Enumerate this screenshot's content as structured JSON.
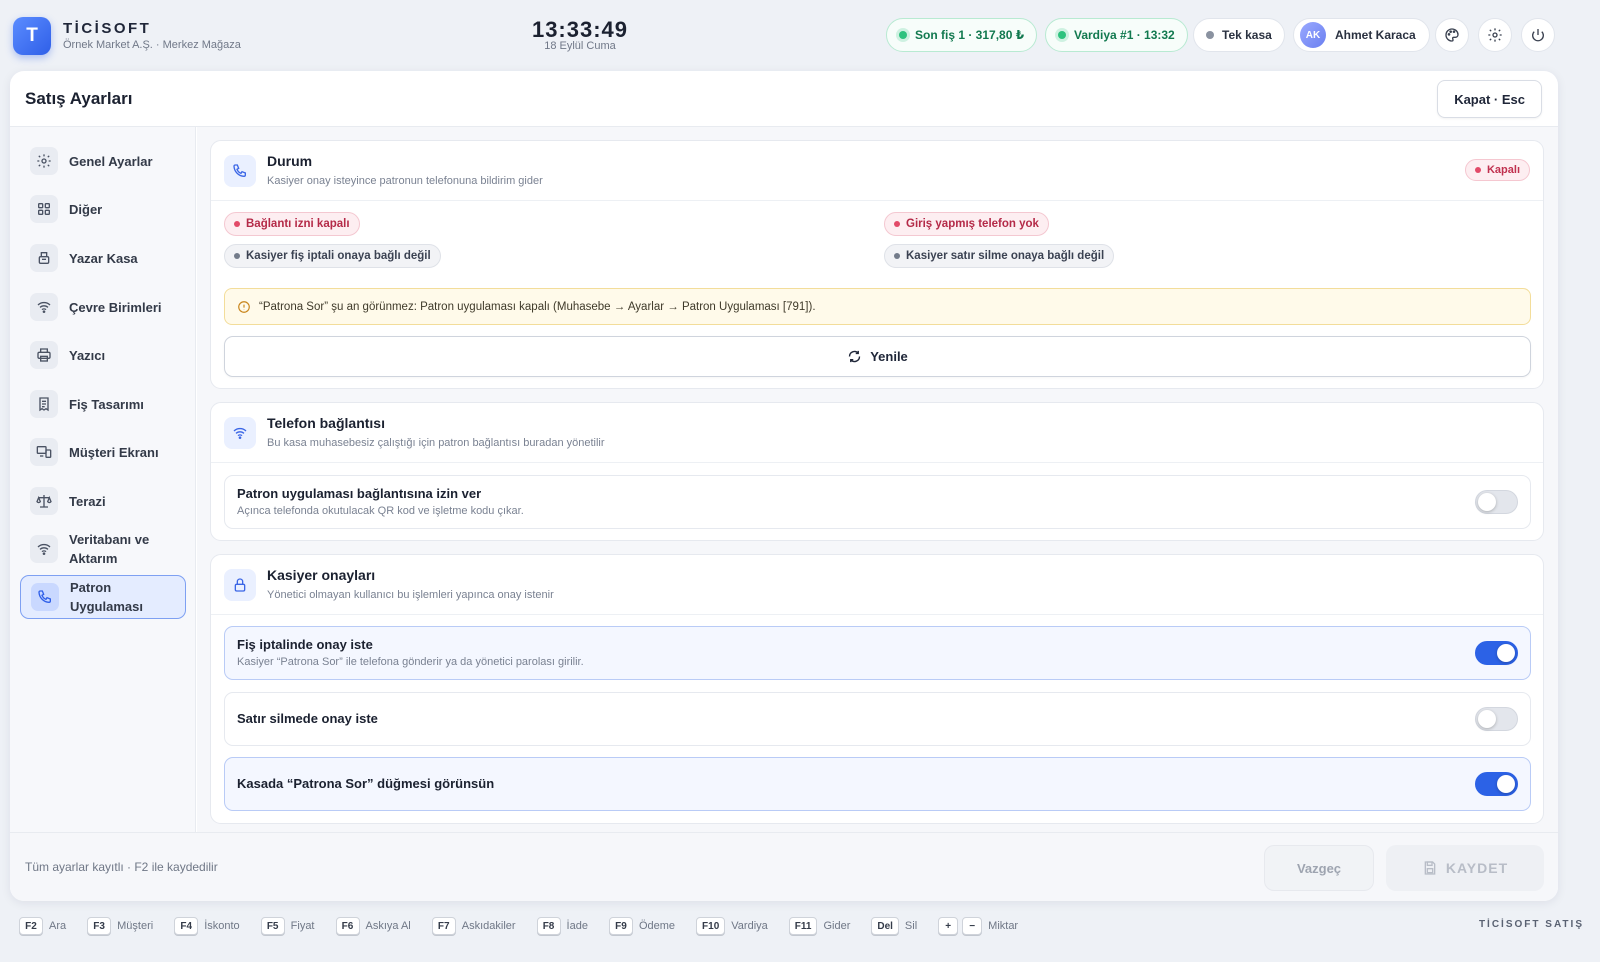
{
  "header": {
    "logo_letter": "T",
    "brand": "TİCİSOFT",
    "subtitle": "Örnek Market A.Ş. · Merkez Mağaza",
    "clock": "13:33:49",
    "date": "18 Eylül Cuma",
    "last_receipt": "Son fiş 1 · 317,80 ₺",
    "shift": "Vardiya #1 · 13:32",
    "register": "Tek kasa",
    "user_initials": "AK",
    "user_name": "Ahmet Karaca"
  },
  "panel": {
    "title": "Satış Ayarları",
    "close_label": "Kapat · Esc"
  },
  "sidebar": {
    "items": [
      {
        "label": "Genel Ayarlar",
        "icon": "gear-icon"
      },
      {
        "label": "Diğer",
        "icon": "grid-icon"
      },
      {
        "label": "Yazar Kasa",
        "icon": "cash-register-icon"
      },
      {
        "label": "Çevre Birimleri",
        "icon": "wifi-icon"
      },
      {
        "label": "Yazıcı",
        "icon": "printer-icon"
      },
      {
        "label": "Fiş Tasarımı",
        "icon": "receipt-icon"
      },
      {
        "label": "Müşteri Ekranı",
        "icon": "monitor-icon"
      },
      {
        "label": "Terazi",
        "icon": "scale-icon"
      },
      {
        "label": "Veritabanı ve Aktarım",
        "icon": "wifi-icon"
      },
      {
        "label": "Patron Uygulaması",
        "icon": "phone-icon",
        "active": true
      }
    ]
  },
  "status_card": {
    "title": "Durum",
    "subtitle": "Kasiyer onay isteyince patronun telefonuna bildirim gider",
    "badge": "Kapalı",
    "chips": [
      "Bağlantı izni kapalı",
      "Giriş yapmış telefon yok",
      "Kasiyer fiş iptali onaya bağlı değil",
      "Kasiyer satır silme onaya bağlı değil"
    ],
    "warning": "“Patrona Sor” şu an görünmez: Patron uygulaması kapalı (Muhasebe → Ayarlar → Patron Uygulaması [791]).",
    "refresh_label": "Yenile"
  },
  "phone_card": {
    "title": "Telefon bağlantısı",
    "subtitle": "Bu kasa muhasebesiz çalıştığı için patron bağlantısı buradan yönetilir",
    "row_title": "Patron uygulaması bağlantısına izin ver",
    "row_sub": "Açınca telefonda okutulacak QR kod ve işletme kodu çıkar.",
    "row_on": false
  },
  "cashier_card": {
    "title": "Kasiyer onayları",
    "subtitle": "Yönetici olmayan kullanıcı bu işlemleri yapınca onay istenir",
    "rows": [
      {
        "title": "Fiş iptalinde onay iste",
        "sub": "Kasiyer “Patrona Sor” ile telefona gönderir ya da yönetici parolası girilir.",
        "on": true
      },
      {
        "title": "Satır silmede onay iste",
        "sub": "",
        "on": false
      },
      {
        "title": "Kasada “Patrona Sor” düğmesi görünsün",
        "sub": "",
        "on": true
      }
    ]
  },
  "footer": {
    "note": "Tüm ayarlar kayıtlı · F2 ile kaydedilir",
    "cancel_label": "Vazgeç",
    "save_label": "KAYDET"
  },
  "shortcuts": [
    {
      "keys": [
        "F2"
      ],
      "label": "Ara"
    },
    {
      "keys": [
        "F3"
      ],
      "label": "Müşteri"
    },
    {
      "keys": [
        "F4"
      ],
      "label": "İskonto"
    },
    {
      "keys": [
        "F5"
      ],
      "label": "Fiyat"
    },
    {
      "keys": [
        "F6"
      ],
      "label": "Askıya Al"
    },
    {
      "keys": [
        "F7"
      ],
      "label": "Askıdakiler"
    },
    {
      "keys": [
        "F8"
      ],
      "label": "İade"
    },
    {
      "keys": [
        "F9"
      ],
      "label": "Ödeme"
    },
    {
      "keys": [
        "F10"
      ],
      "label": "Vardiya"
    },
    {
      "keys": [
        "F11"
      ],
      "label": "Gider"
    },
    {
      "keys": [
        "Del"
      ],
      "label": "Sil"
    },
    {
      "keys": [
        "+",
        "−"
      ],
      "label": "Miktar"
    }
  ],
  "footer_brand": "TİCİSOFT SATIŞ",
  "colors": {
    "accent": "#2c62e6",
    "success": "#2ec27e",
    "danger": "#e24a68",
    "warning_bg": "#fffaea"
  }
}
